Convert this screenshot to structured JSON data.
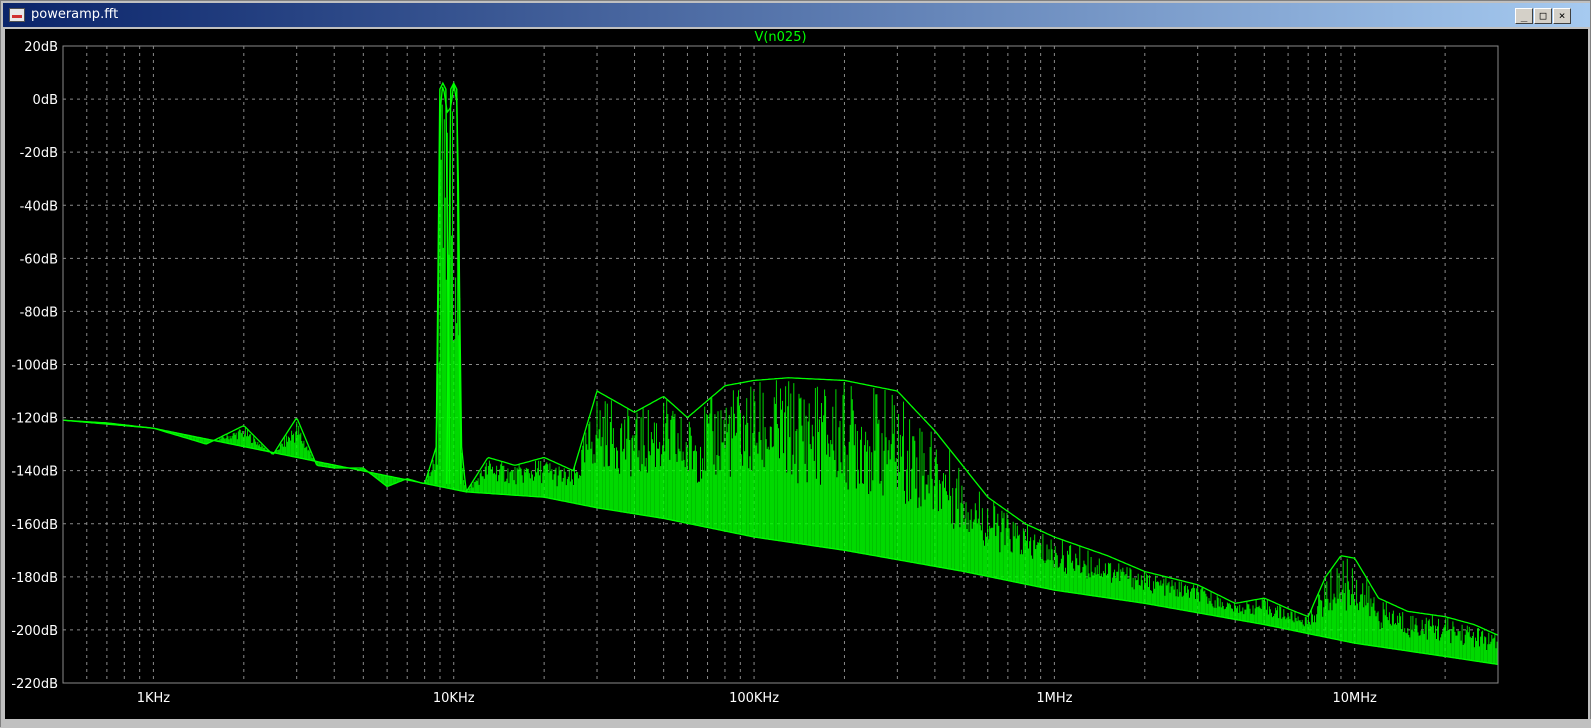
{
  "window": {
    "title": "poweramp.fft",
    "controls": {
      "minimize": "_",
      "maximize": "□",
      "close": "×"
    }
  },
  "colors": {
    "trace": "#00ff00",
    "background": "#000000",
    "grid": "#8a8a8a",
    "axis_text": "#ffffff",
    "title_text": "#00ff00"
  },
  "chart_data": {
    "type": "line",
    "title": "V(n025)",
    "xscale": "log",
    "xlim": [
      500,
      30000000
    ],
    "ylim": [
      -220,
      20
    ],
    "grid": true,
    "grid_style": "dashed",
    "x_ticks": [
      {
        "value": 1000,
        "label": "1KHz"
      },
      {
        "value": 10000,
        "label": "10KHz"
      },
      {
        "value": 100000,
        "label": "100KHz"
      },
      {
        "value": 1000000,
        "label": "1MHz"
      },
      {
        "value": 10000000,
        "label": "10MHz"
      }
    ],
    "y_ticks": [
      {
        "value": 20,
        "label": "20dB"
      },
      {
        "value": 0,
        "label": "0dB"
      },
      {
        "value": -20,
        "label": "-20dB"
      },
      {
        "value": -40,
        "label": "-40dB"
      },
      {
        "value": -60,
        "label": "-60dB"
      },
      {
        "value": -80,
        "label": "-80dB"
      },
      {
        "value": -100,
        "label": "-100dB"
      },
      {
        "value": -120,
        "label": "-120dB"
      },
      {
        "value": -140,
        "label": "-140dB"
      },
      {
        "value": -160,
        "label": "-160dB"
      },
      {
        "value": -180,
        "label": "-180dB"
      },
      {
        "value": -200,
        "label": "-200dB"
      },
      {
        "value": -220,
        "label": "-220dB"
      }
    ],
    "series": [
      {
        "name": "V(n025)",
        "envelope_upper": {
          "x": [
            500,
            700,
            1000,
            1500,
            2000,
            2500,
            3000,
            3500,
            4000,
            5000,
            6000,
            7000,
            8000,
            8800,
            9000,
            9200,
            9500,
            9800,
            10000,
            10300,
            10600,
            11000,
            13000,
            16000,
            20000,
            25000,
            30000,
            40000,
            50000,
            60000,
            80000,
            100000,
            130000,
            200000,
            300000,
            400000,
            600000,
            800000,
            1000000,
            1500000,
            2000000,
            3000000,
            4000000,
            5000000,
            6000000,
            7000000,
            8000000,
            9000000,
            10000000,
            12000000,
            15000000,
            20000000,
            25000000,
            30000000
          ],
          "y": [
            -121,
            -122,
            -124,
            -130,
            -123,
            -134,
            -120,
            -138,
            -139,
            -139,
            -146,
            -143,
            -145,
            -130,
            -5,
            6,
            -5,
            -3,
            6,
            -3,
            -130,
            -148,
            -135,
            -138,
            -135,
            -140,
            -110,
            -118,
            -112,
            -120,
            -108,
            -106,
            -105,
            -106,
            -110,
            -125,
            -150,
            -160,
            -165,
            -172,
            -178,
            -183,
            -190,
            -188,
            -192,
            -195,
            -180,
            -172,
            -173,
            -188,
            -193,
            -195,
            -198,
            -202
          ]
        },
        "envelope_lower": {
          "x": [
            500,
            1000,
            9000,
            11000,
            20000,
            30000,
            50000,
            100000,
            200000,
            500000,
            1000000,
            2000000,
            5000000,
            10000000,
            20000000,
            30000000
          ],
          "y": [
            -121,
            -124,
            -146,
            -148,
            -150,
            -154,
            -158,
            -165,
            -170,
            -178,
            -185,
            -190,
            -198,
            -205,
            -210,
            -213
          ]
        }
      }
    ]
  }
}
